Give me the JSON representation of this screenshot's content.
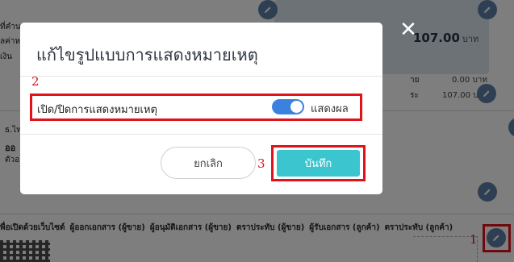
{
  "background": {
    "total_amount": "107.00",
    "total_unit": "บาท",
    "rows": [
      {
        "label": "าย",
        "value": "0.00 บาท"
      },
      {
        "label": "ระ",
        "value": "107.00 บาท"
      }
    ],
    "left_fragments": [
      "ที่คำน",
      "ลค่าห",
      "เงิน",
      "ธ.ไท",
      "ออ",
      "ตัวอ"
    ],
    "signature_headers": [
      "พื่อเปิดด้วยเว็บไซต์",
      "ผู้ออกเอกสาร (ผู้ขาย)",
      "ผู้อนุมัติเอกสาร (ผู้ขาย)",
      "ตราประทับ (ผู้ขาย)",
      "ผู้รับเอกสาร (ลูกค้า)",
      "ตราประทับ (ลูกค้า)"
    ],
    "annotation_1": "1"
  },
  "modal": {
    "title": "แก้ไขรูปแบบการแสดงหมายเหตุ",
    "annotation_2": "2",
    "annotation_3": "3",
    "setting_label": "เปิด/ปิดการแสดงหมายเหตุ",
    "toggle_state_label": "แสดงผล",
    "toggle_on": true,
    "cancel_label": "ยกเลิก",
    "save_label": "บันทึก"
  },
  "colors": {
    "accent_toggle": "#3b82e0",
    "save_button": "#3bc6cf",
    "annotation_red": "#e1121a",
    "edit_icon_bg": "#5f7fa6"
  }
}
